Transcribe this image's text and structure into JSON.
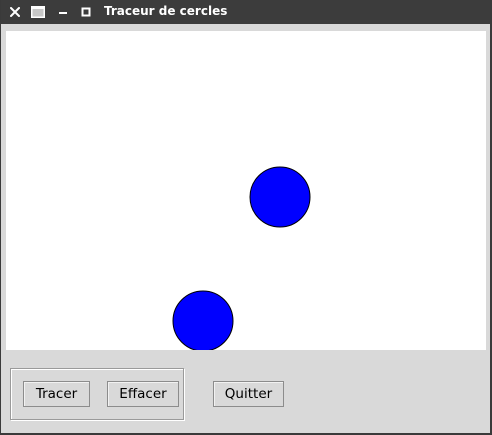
{
  "window": {
    "title": "Traceur de cercles",
    "controls": [
      "close-icon",
      "window-menu-icon",
      "minimize-icon",
      "maximize-icon"
    ]
  },
  "canvas": {
    "background": "#ffffff",
    "circle_fill": "#0000ff",
    "circle_stroke": "#000000",
    "circle_count": 2
  },
  "buttons": {
    "tracer": "Tracer",
    "effacer": "Effacer",
    "quitter": "Quitter"
  },
  "colors": {
    "titlebar": "#3c3c3c",
    "window_bg": "#d9d9d9"
  }
}
